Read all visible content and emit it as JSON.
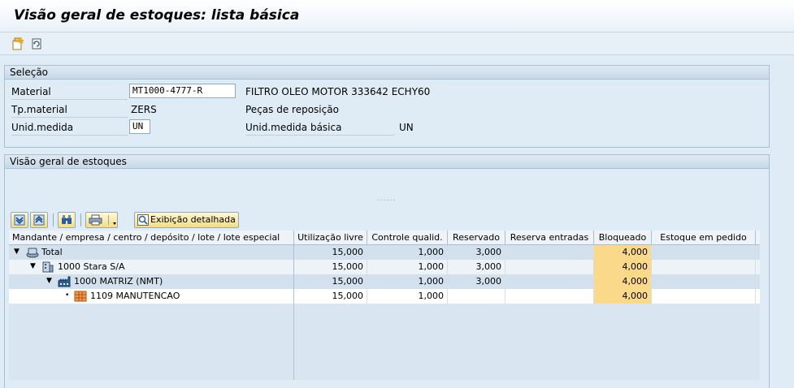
{
  "title": "Visão geral de estoques: lista básica",
  "toolbar": {
    "icons": [
      "new-document-icon",
      "refresh-icon"
    ]
  },
  "selection": {
    "header": "Seleção",
    "material_label": "Material",
    "material_value": "MT1000-4777-R",
    "material_description": "FILTRO OLEO MOTOR 333642 ECHY60",
    "tpmaterial_label": "Tp.material",
    "tpmaterial_value": "ZERS",
    "tpmaterial_description": "Peças de reposição",
    "unid_label": "Unid.medida",
    "unid_value": "UN",
    "unid_base_label": "Unid.medida básica",
    "unid_base_value": "UN"
  },
  "overview": {
    "header": "Visão geral de estoques",
    "splitter": "......",
    "detail_button": "Exibição detalhada",
    "columns": [
      "Mandante / empresa / centro / depósito / lote / lote especial",
      "Utilização livre",
      "Controle qualid.",
      "Reservado",
      "Reserva entradas",
      "Bloqueado",
      "Estoque em pedido"
    ],
    "rows": [
      {
        "arrow": "▼",
        "icon": "client-icon",
        "label": "Total",
        "livre": "15,000",
        "qualid": "1,000",
        "reservado": "3,000",
        "entradas": "",
        "bloqueado": "4,000",
        "pedido": ""
      },
      {
        "arrow": "▼",
        "icon": "company-icon",
        "label": "1000 Stara S/A",
        "livre": "15,000",
        "qualid": "1,000",
        "reservado": "3,000",
        "entradas": "",
        "bloqueado": "4,000",
        "pedido": ""
      },
      {
        "arrow": "▼",
        "icon": "plant-icon",
        "label": "1000 MATRIZ (NMT)",
        "livre": "15,000",
        "qualid": "1,000",
        "reservado": "3,000",
        "entradas": "",
        "bloqueado": "4,000",
        "pedido": ""
      },
      {
        "arrow": "•",
        "icon": "storage-location-icon",
        "label": "1109 MANUTENCAO",
        "livre": "15,000",
        "qualid": "1,000",
        "reservado": "",
        "entradas": "",
        "bloqueado": "4,000",
        "pedido": ""
      }
    ]
  },
  "colors": {
    "background": "#dfebf5",
    "blocked_highlight": "#fbd98a",
    "border": "#a8c0d6"
  }
}
